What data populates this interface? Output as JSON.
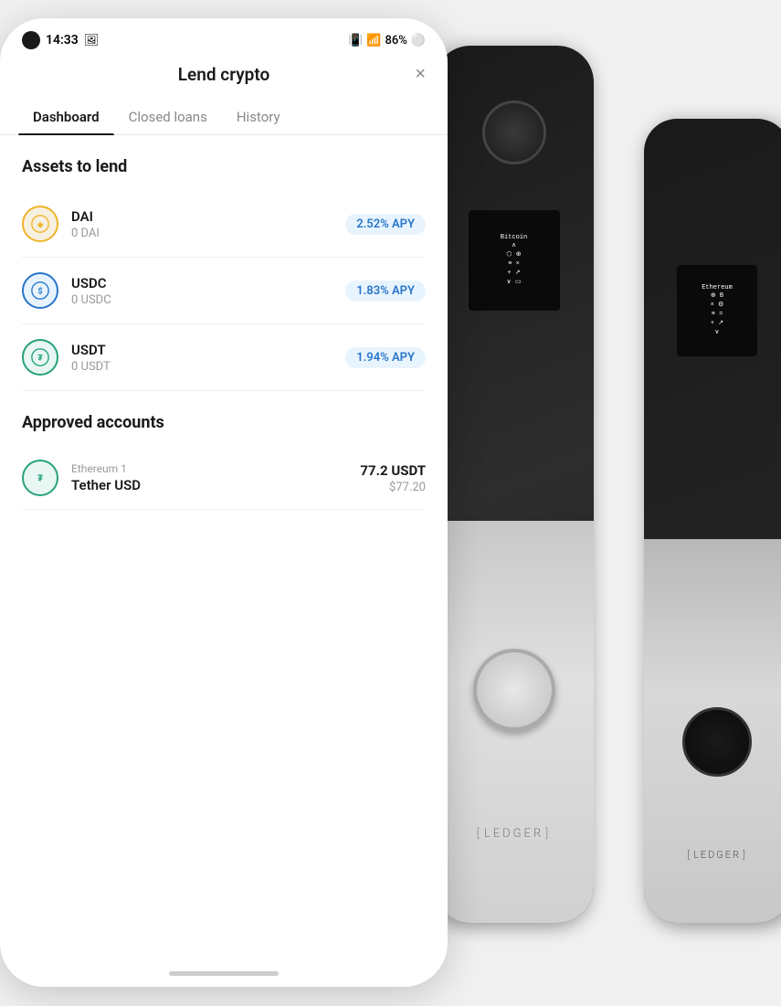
{
  "statusBar": {
    "time": "14:33",
    "battery": "86%"
  },
  "header": {
    "title": "Lend crypto",
    "closeLabel": "×"
  },
  "tabs": [
    {
      "id": "dashboard",
      "label": "Dashboard",
      "active": true
    },
    {
      "id": "closed-loans",
      "label": "Closed loans",
      "active": false
    },
    {
      "id": "history",
      "label": "History",
      "active": false
    }
  ],
  "assetsSection": {
    "title": "Assets to lend",
    "assets": [
      {
        "id": "dai",
        "name": "DAI",
        "balance": "0 DAI",
        "apy": "2.52% APY"
      },
      {
        "id": "usdc",
        "name": "USDC",
        "balance": "0 USDC",
        "apy": "1.83% APY"
      },
      {
        "id": "usdt",
        "name": "USDT",
        "balance": "0 USDT",
        "apy": "1.94% APY"
      }
    ]
  },
  "approvedSection": {
    "title": "Approved accounts",
    "accounts": [
      {
        "id": "tether-usd",
        "accountLabel": "Ethereum 1",
        "name": "Tether USD",
        "amount": "77.2 USDT",
        "amountUsd": "$77.20"
      }
    ]
  },
  "ledger": {
    "frontScreenText": "Bitcoin\n× ⚙\n≡ ↑\n+ ↗\n∨ ▭",
    "backScreenText": "Ethereum\n⚙ B\n× ⚙\n≡ =\n+ ↗\n∨"
  }
}
